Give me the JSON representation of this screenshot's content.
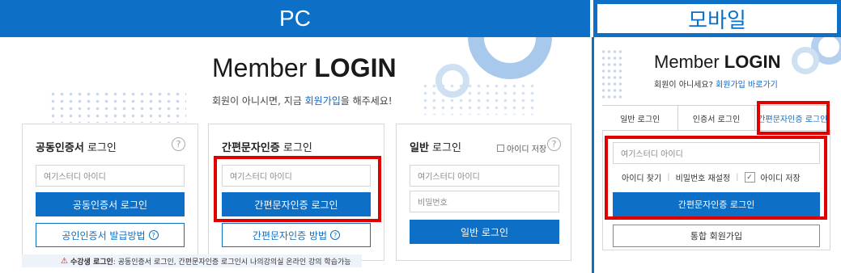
{
  "headers": {
    "pc": "PC",
    "mobile": "모바일"
  },
  "pc": {
    "title_light": "Member ",
    "title_bold": "LOGIN",
    "subtitle_pre": "회원이 아니시면, 지금 ",
    "subtitle_link": "회원가입",
    "subtitle_post": "을 해주세요!",
    "panels": {
      "cert": {
        "title_bold": "공동인증서",
        "title_rest": " 로그인",
        "id_placeholder": "여기스터디 아이디",
        "login_button": "공동인증서 로그인",
        "guide_button": "공인인증서 발급방법"
      },
      "simple": {
        "title_bold": "간편문자인증",
        "title_rest": " 로그인",
        "id_placeholder": "여기스터디 아이디",
        "login_button": "간편문자인증 로그인",
        "guide_button": "간편문자인증 방법"
      },
      "general": {
        "title_bold": "일반",
        "title_rest": " 로그인",
        "save_id": "아이디 저장",
        "id_placeholder": "여기스터디 아이디",
        "pw_placeholder": "비밀번호",
        "login_button": "일반 로그인"
      }
    },
    "help_symbol": "?",
    "notice_bold": "수강생 로그인",
    "notice_text": " : 공동인증서 로그인, 간편문자인증 로그인시 나의강의실 온라인 강의 학습가능",
    "notice_icon": "warning-icon"
  },
  "mobile": {
    "title_light": "Member ",
    "title_bold": "LOGIN",
    "subtitle_pre": "회원이 아니세요? ",
    "subtitle_link": "회원가입 바로가기",
    "tabs": [
      "일반 로그인",
      "인증서 로그인",
      "간편문자인증 로그인"
    ],
    "active_tab": 2,
    "id_placeholder": "여기스터디 아이디",
    "find_id": "아이디 찾기",
    "reset_pw": "비밀번호 재설정",
    "save_id": "아이디 저장",
    "save_id_checked": true,
    "login_button": "간편문자인증 로그인",
    "join_button": "통합 회원가입"
  },
  "colors": {
    "brand": "#0d6fc5",
    "highlight": "#e00000",
    "link": "#1565c0"
  }
}
